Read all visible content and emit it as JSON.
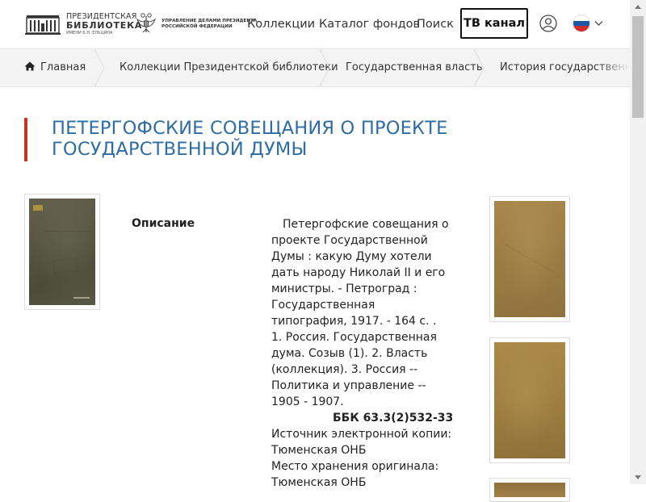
{
  "header": {
    "logo_library": {
      "line1": "ПРЕЗИДЕНТСКАЯ",
      "line2": "БИБЛИОТЕКА",
      "line3": "ИМЕНИ Б.Н. ЕЛЬЦИНА"
    },
    "logo_admin": {
      "line1": "УПРАВЛЕНИЕ ДЕЛАМИ ПРЕЗИДЕНТА",
      "line2": "РОССИЙСКОЙ ФЕДЕРАЦИИ"
    },
    "nav": [
      {
        "label": "Коллекции"
      },
      {
        "label": "Каталог фондов"
      },
      {
        "label": "Поиск"
      }
    ],
    "tv_button": "ТВ канал",
    "icons": {
      "user": "user-icon",
      "language": "russian-flag-icon",
      "dropdown": "chevron-down-icon"
    }
  },
  "breadcrumb": [
    {
      "label": "Главная",
      "icon": "home-icon"
    },
    {
      "label": "Коллекции Президентской библиотеки"
    },
    {
      "label": "Государственная власть"
    },
    {
      "label": "История государственной власти"
    }
  ],
  "document": {
    "title": "ПЕТЕРГОФСКИЕ СОВЕЩАНИЯ О ПРОЕКТЕ ГОСУДАРСТВЕННОЙ ДУМЫ",
    "description_label": "Описание",
    "description": {
      "main": "Петергофские совещания о проекте Государственной Думы : какую Думу хотели дать народу Николай II и его министры. - Петроград : Государственная типография, 1917. - 164 с. .",
      "subjects": "1. Россия. Государственная дума. Созыв (1). 2. Власть (коллекция). 3. Россия -- Политика и управление -- 1905 - 1907.",
      "bbk": "ББК 63.3(2)532-33",
      "source": "Источник электронной копии: Тюменская ОНБ",
      "storage": "Место хранения оригинала: Тюменская ОНБ"
    }
  },
  "colors": {
    "title": "#2e6ca4",
    "accent_bar": "#c8361f",
    "breadcrumb_bg": "#f4f4f4"
  }
}
